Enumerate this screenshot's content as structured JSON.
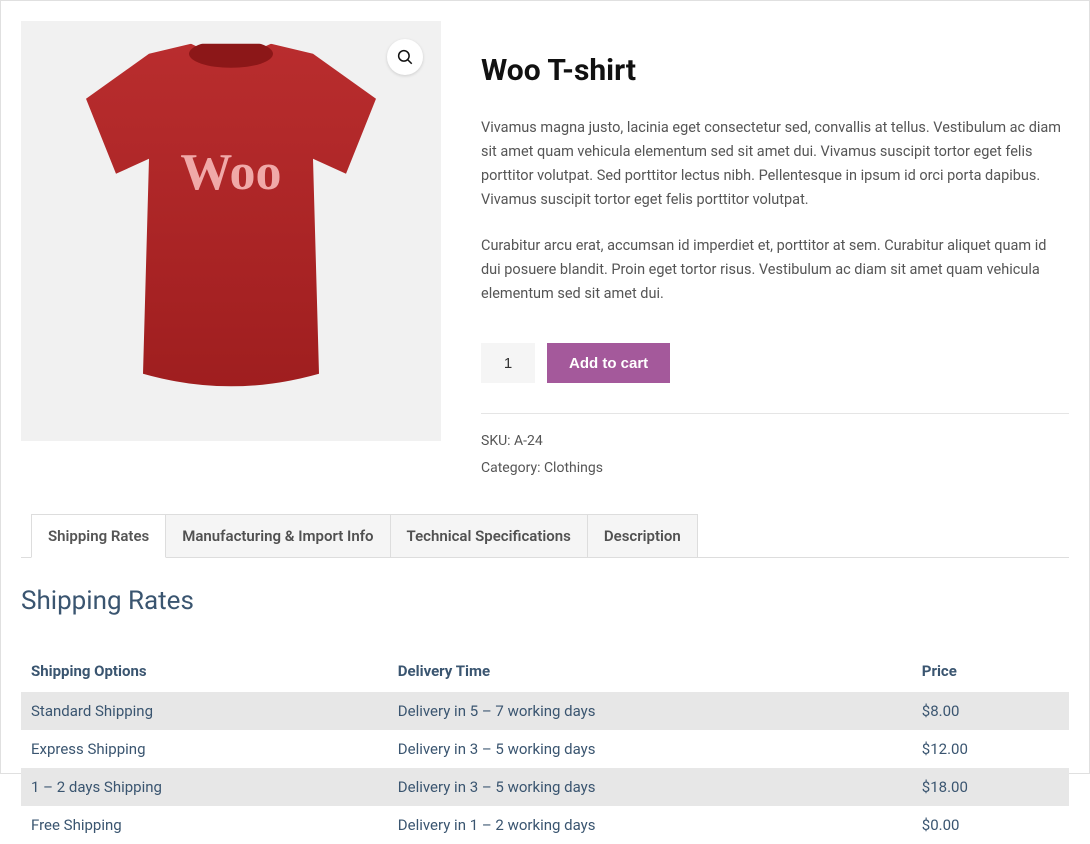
{
  "product": {
    "title": "Woo T-shirt",
    "image_text": "Woo",
    "desc1": "Vivamus magna justo, lacinia eget consectetur sed, convallis at tellus. Vestibulum ac diam sit amet quam vehicula elementum sed sit amet dui. Vivamus suscipit tortor eget felis porttitor volutpat. Sed porttitor lectus nibh. Pellentesque in ipsum id orci porta dapibus. Vivamus suscipit tortor eget felis porttitor volutpat.",
    "desc2": "Curabitur arcu erat, accumsan id imperdiet et, porttitor at sem. Curabitur aliquet quam id dui posuere blandit. Proin eget tortor risus. Vestibulum ac diam sit amet quam vehicula elementum sed sit amet dui.",
    "quantity": "1",
    "add_to_cart": "Add to cart",
    "sku_label": "SKU: ",
    "sku_value": "A-24",
    "category_label": "Category: ",
    "category_value": "Clothings"
  },
  "tabs": {
    "shipping": "Shipping Rates",
    "manufacturing": "Manufacturing & Import Info",
    "tech": "Technical Specifications",
    "description": "Description"
  },
  "tab_heading": "Shipping Rates",
  "table": {
    "headers": {
      "option": "Shipping Options",
      "time": "Delivery Time",
      "price": "Price"
    },
    "rows": [
      {
        "option": "Standard Shipping",
        "time": "Delivery in 5 – 7 working days",
        "price": "$8.00"
      },
      {
        "option": "Express Shipping",
        "time": "Delivery in 3 – 5 working days",
        "price": "$12.00"
      },
      {
        "option": "1 – 2 days Shipping",
        "time": "Delivery in 3 – 5 working days",
        "price": "$18.00"
      },
      {
        "option": "Free Shipping",
        "time": "Delivery in 1 – 2 working days",
        "price": "$0.00"
      }
    ]
  }
}
